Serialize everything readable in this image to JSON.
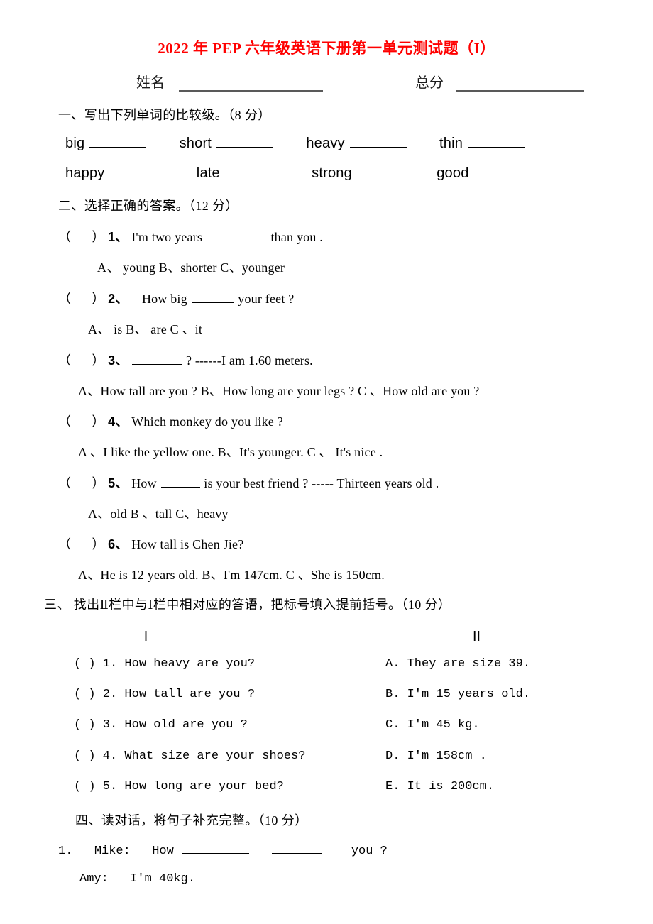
{
  "document": {
    "title": "2022 年 PEP 六年级英语下册第一单元测试题（I）",
    "title_color": "#ff0000",
    "name_label": "姓名",
    "score_label": "总分"
  },
  "section1": {
    "heading": "一、写出下列单词的比较级。（8 分）",
    "row1": [
      {
        "word": "big"
      },
      {
        "word": "short"
      },
      {
        "word": "heavy"
      },
      {
        "word": "thin"
      }
    ],
    "row2": [
      {
        "word": "happy"
      },
      {
        "word": "late"
      },
      {
        "word": "strong"
      },
      {
        "word": "good"
      }
    ]
  },
  "section2": {
    "heading": "二、选择正确的答案。（12 分）",
    "questions": [
      {
        "bracket_open": "（",
        "bracket_close": "）",
        "number": "1、",
        "stem_before": "I'm two years",
        "stem_after": "than you .",
        "options": "A、  young  B、shorter   C、younger"
      },
      {
        "bracket_open": "（",
        "bracket_close": "）",
        "number": "2、",
        "stem_before": "How  big",
        "stem_after": "your feet ?",
        "options": "A、  is  B、   are  C 、it"
      },
      {
        "bracket_open": "（",
        "bracket_close": "）",
        "number": "3、",
        "stem_before": "",
        "stem_after": "?     ------I am 1.60 meters.",
        "options": "A、How tall are you ?   B、How long are your legs ?  C 、How old are you ?"
      },
      {
        "bracket_open": "（",
        "bracket_close": "）",
        "number": "4、",
        "stem_before": "Which  monkey  do  you  like ?",
        "stem_after": "",
        "options": "A 、I like the yellow one.  B、It's younger.   C 、   It's nice ."
      },
      {
        "bracket_open": "（",
        "bracket_close": "）",
        "number": "5、",
        "stem_before": "How",
        "stem_after": "is your best friend ?  ----- Thirteen years old .",
        "options": "A、old  B 、tall  C、heavy"
      },
      {
        "bracket_open": "（",
        "bracket_close": "）",
        "number": "6、",
        "stem_before": "How  tall  is  Chen Jie?",
        "stem_after": "",
        "options": "A、He is 12 years old.   B、I'm 147cm.   C 、She is 150cm."
      }
    ]
  },
  "section3": {
    "heading": "三、 找出Ⅱ栏中与Ⅰ栏中相对应的答语，把标号填入提前括号。（10 分）",
    "column_left_header": "Ⅰ",
    "column_right_header": "Ⅱ",
    "left_items": [
      "(    ) 1. How heavy are you?",
      "(    ) 2. How tall are you ?",
      "(    ) 3. How old are you ?",
      "(    ) 4. What size are your shoes?",
      "(    ) 5. How long are your bed?"
    ],
    "right_items": [
      "A. They are size 39.",
      "B. I'm 15 years old.",
      "C. I'm 45 kg.",
      "D. I'm 158cm .",
      "E. It is 200cm."
    ]
  },
  "section4": {
    "heading": "四、读对话，将句子补充完整。（10 分）",
    "dialogue": [
      {
        "number": "1.",
        "speaker": "Mike:",
        "text_before": "How",
        "text_after": "you ?"
      },
      {
        "number": "",
        "speaker": "Amy:",
        "text_before": "I'm 40kg.",
        "text_after": ""
      }
    ]
  }
}
